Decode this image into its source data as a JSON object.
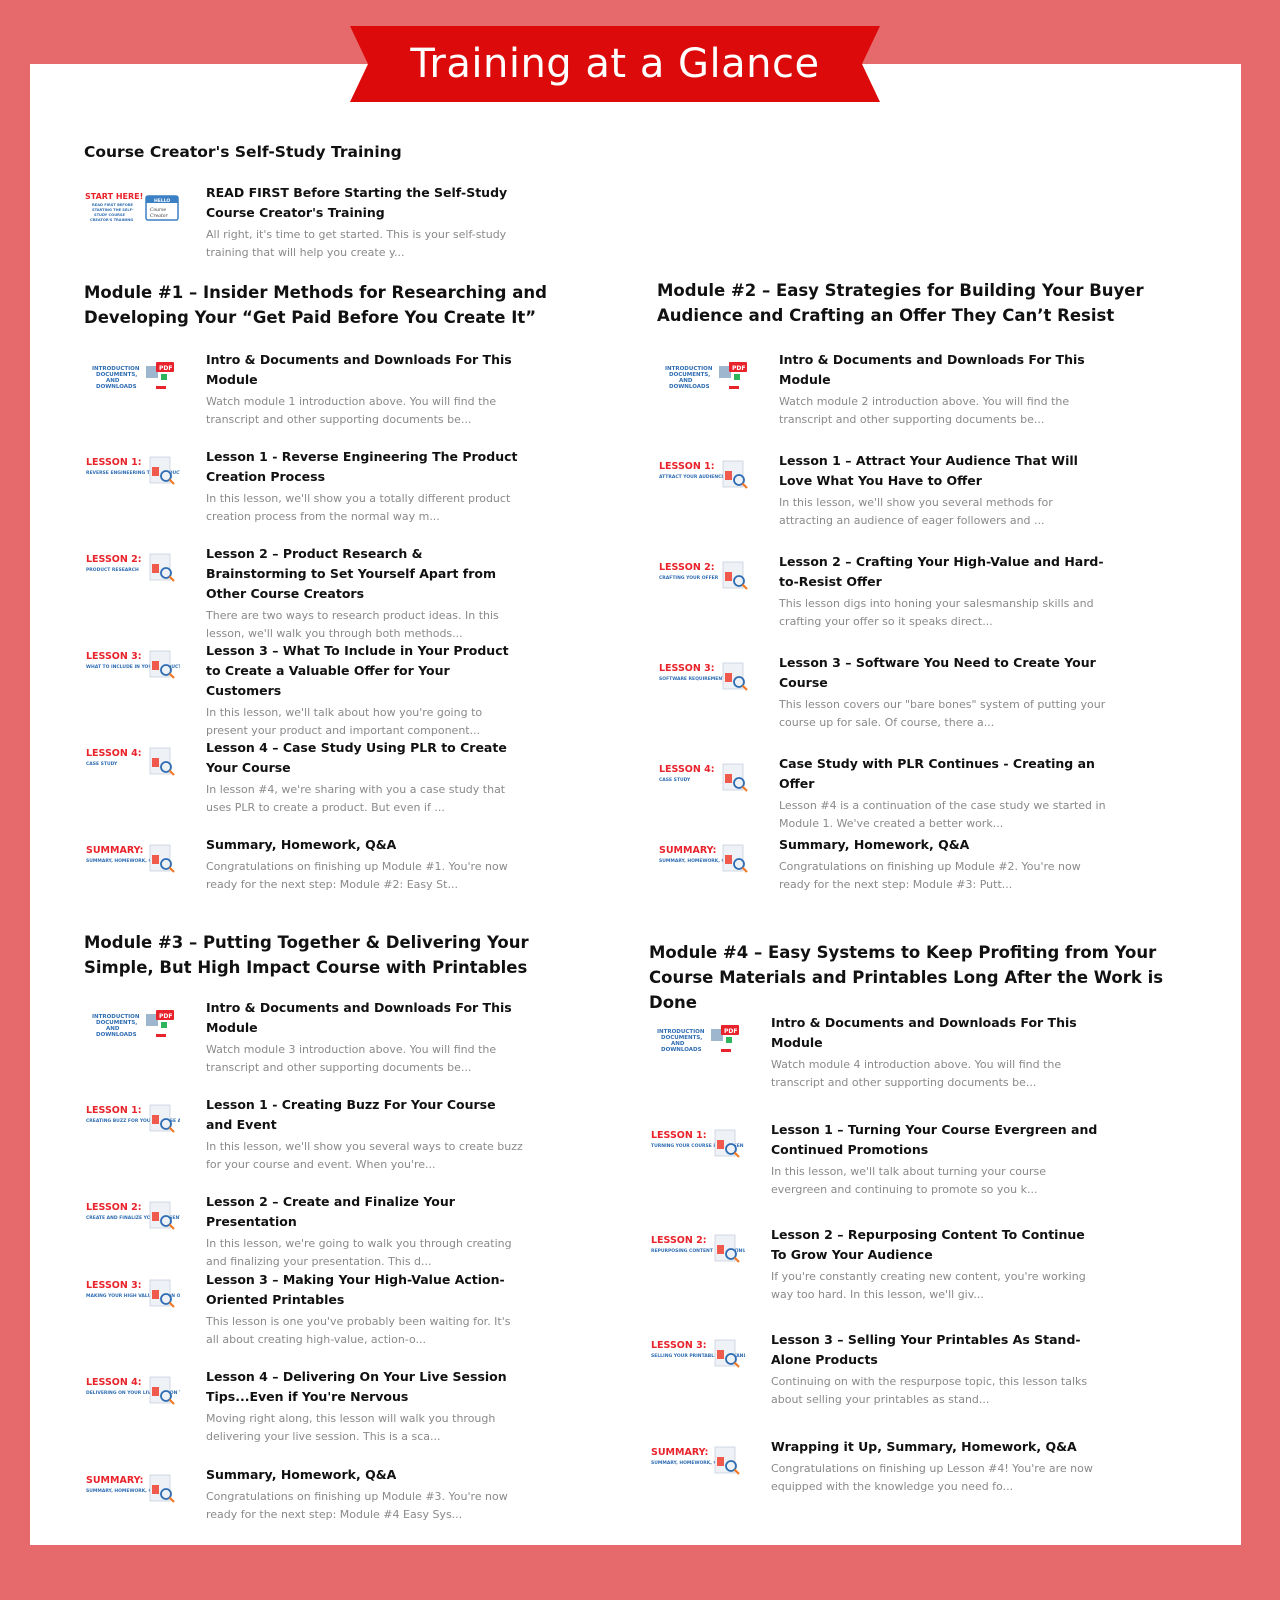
{
  "banner": {
    "title": "Training at a Glance"
  },
  "colors": {
    "frame": "#e6696b",
    "banner": "#dc0a0a",
    "panel": "#ffffff",
    "title_text": "#111111",
    "desc_text": "#8a8a8a",
    "thumb_red": "#e8232b",
    "thumb_blue": "#2f6db3"
  },
  "intro": {
    "title": "Course Creator's Self-Study Training",
    "items": [
      {
        "thumb": {
          "label": "START HERE!",
          "sub": "READ FIRST BEFORE STARTING THE SELF-STUDY COURSE CREATOR'S TRAINING",
          "icon": "name-tag-icon"
        },
        "title": "READ FIRST Before Starting the Self-Study Course Creator's Training",
        "desc": "All right, it's time to get started. This is your self-study training that will help you create y..."
      }
    ]
  },
  "modules": [
    {
      "title": "Module #1 – Insider Methods for Researching and Developing Your “Get Paid Before You Create It”",
      "items": [
        {
          "thumb": {
            "label": "INTRODUCTION DOCUMENTS, AND DOWNLOADS",
            "sub": "",
            "icon": "pdf-download-icon"
          },
          "title": "Intro & Documents and Downloads For This Module",
          "desc": "Watch module 1 introduction above. You will find the transcript and other supporting documents be..."
        },
        {
          "thumb": {
            "label": "LESSON 1:",
            "sub": "REVERSE ENGINEERING THE PRODUCT CREATION PROCESS",
            "icon": "gear-cycle-icon"
          },
          "title": "Lesson 1 - Reverse Engineering The Product Creation Process",
          "desc": "In this lesson, we'll show you a totally different product creation process from the normal way m..."
        },
        {
          "thumb": {
            "label": "LESSON 2:",
            "sub": "PRODUCT RESEARCH",
            "icon": "box-magnifier-icon"
          },
          "title": "Lesson 2 – Product Research & Brainstorming to Set Yourself Apart from Other Course Creators",
          "desc": "There are two ways to research product ideas. In this lesson, we'll walk you through both methods..."
        },
        {
          "thumb": {
            "label": "LESSON 3:",
            "sub": "WHAT TO INCLUDE IN YOUR PRODUCT",
            "icon": "checklist-icon"
          },
          "title": "Lesson 3 – What To Include in Your Product to Create a Valuable Offer for Your Customers",
          "desc": "In this lesson, we'll talk about how you're going to present your product and important component..."
        },
        {
          "thumb": {
            "label": "LESSON 4:",
            "sub": "CASE STUDY",
            "icon": "case-study-icon"
          },
          "title": "Lesson 4 – Case Study Using PLR to Create Your Course",
          "desc": "In lesson #4, we're sharing with you a case study that uses PLR to create a product. But even if ..."
        },
        {
          "thumb": {
            "label": "SUMMARY:",
            "sub": "SUMMARY, HOMEWORK, Q&A",
            "icon": "summary-doc-icon"
          },
          "title": "Summary, Homework, Q&A",
          "desc": "Congratulations on finishing up Module #1. You're now ready for the next step: Module #2: Easy St..."
        }
      ]
    },
    {
      "title": "Module #2 – Easy Strategies for Building Your Buyer Audience and Crafting an Offer They Can’t Resist",
      "items": [
        {
          "thumb": {
            "label": "INTRODUCTION DOCUMENTS, AND DOWNLOADS",
            "sub": "",
            "icon": "pdf-download-icon"
          },
          "title": "Intro & Documents and Downloads For This Module",
          "desc": "Watch module 2 introduction above. You will find the transcript and other supporting documents be..."
        },
        {
          "thumb": {
            "label": "LESSON 1:",
            "sub": "ATTRACT YOUR AUDIENCE",
            "icon": "audience-icon"
          },
          "title": "Lesson 1 – Attract Your Audience That Will Love What You Have to Offer",
          "desc": "In this lesson, we'll show you several methods for attracting an audience of eager followers and ..."
        },
        {
          "thumb": {
            "label": "LESSON 2:",
            "sub": "CRAFTING YOUR OFFER",
            "icon": "offer-icon"
          },
          "title": "Lesson 2 – Crafting Your High-Value and Hard-to-Resist Offer",
          "desc": "This lesson digs into honing your salesmanship skills and crafting your offer so it speaks direct..."
        },
        {
          "thumb": {
            "label": "LESSON 3:",
            "sub": "SOFTWARE REQUIREMENTS",
            "icon": "software-icon"
          },
          "title": "Lesson 3 – Software You Need to Create Your Course",
          "desc": "This lesson covers our \"bare bones\" system of putting your course up for sale. Of course, there a..."
        },
        {
          "thumb": {
            "label": "LESSON 4:",
            "sub": "CASE STUDY",
            "icon": "case-study-icon"
          },
          "title": "Case Study with PLR Continues - Creating an Offer",
          "desc": "Lesson #4 is a continuation of the case study we started in Module 1. We've created a better work..."
        },
        {
          "thumb": {
            "label": "SUMMARY:",
            "sub": "SUMMARY, HOMEWORK, Q&A",
            "icon": "case-study-icon"
          },
          "title": "Summary, Homework, Q&A",
          "desc": "Congratulations on finishing up Module #2.  You're now ready for the next step: Module #3: Putt..."
        }
      ]
    },
    {
      "title": "Module #3 – Putting Together & Delivering Your Simple, But High Impact Course with Printables",
      "items": [
        {
          "thumb": {
            "label": "INTRODUCTION DOCUMENTS, AND DOWNLOADS",
            "sub": "",
            "icon": "pdf-download-icon"
          },
          "title": "Intro & Documents and Downloads For This Module",
          "desc": "Watch module 3 introduction above. You will find the transcript and other supporting documents be..."
        },
        {
          "thumb": {
            "label": "LESSON 1:",
            "sub": "CREATING BUZZ FOR YOUR COURSE AND EVENT",
            "icon": "bee-buzz-icon"
          },
          "title": "Lesson 1 - Creating Buzz For Your Course and Event",
          "desc": "In this lesson, we'll show you several ways to create buzz for your course and event. When you're..."
        },
        {
          "thumb": {
            "label": "LESSON 2:",
            "sub": "CREATE AND FINALIZE YOUR PRESENTATION",
            "icon": "presentation-icon"
          },
          "title": "Lesson 2 – Create and Finalize Your Presentation",
          "desc": "In this lesson, we're going to walk you through creating and finalizing your presentation. This d..."
        },
        {
          "thumb": {
            "label": "LESSON 3:",
            "sub": "MAKING YOUR HIGH VALUE ACTION ORIENTED PRINTABLES",
            "icon": "take-action-icon"
          },
          "title": "Lesson 3 – Making Your High-Value Action-Oriented Printables",
          "desc": "This lesson is one you've probably been waiting for. It's all about creating high-value, action-o..."
        },
        {
          "thumb": {
            "label": "LESSON 4:",
            "sub": "DELIVERING ON YOUR LIVE SESSION TIPS",
            "icon": "live-session-icon"
          },
          "title": "Lesson 4 – Delivering On Your Live Session Tips...Even if You're Nervous",
          "desc": "Moving right along, this lesson will walk you through delivering your live session. This is a sca..."
        },
        {
          "thumb": {
            "label": "SUMMARY:",
            "sub": "SUMMARY, HOMEWORK, Q&A",
            "icon": "case-study-icon"
          },
          "title": "Summary, Homework, Q&A",
          "desc": "Congratulations on finishing up Module #3. You're now ready for the next step: Module #4 Easy Sys..."
        }
      ]
    },
    {
      "title": "Module #4 – Easy Systems to Keep Profiting from Your Course Materials and Printables Long After the Work is Done",
      "items": [
        {
          "thumb": {
            "label": "INTRODUCTION DOCUMENTS, AND DOWNLOADS",
            "sub": "",
            "icon": "pdf-download-icon"
          },
          "title": "Intro & Documents and Downloads For This Module",
          "desc": "Watch module 4 introduction above. You will find the transcript and other supporting documents be..."
        },
        {
          "thumb": {
            "label": "LESSON 1:",
            "sub": "TURNING YOUR COURSE EVERGREEN AND CONTINUED PROMOTIONS",
            "icon": "evergreen-promo-icon"
          },
          "title": "Lesson 1 – Turning Your Course Evergreen and Continued Promotions",
          "desc": "In this lesson, we'll talk about turning your course evergreen and continuing to promote so you k..."
        },
        {
          "thumb": {
            "label": "LESSON 2:",
            "sub": "REPURPOSING CONTENT TO CONTINUE TO GROW YOUR AUDIENCE",
            "icon": "repurpose-icon"
          },
          "title": "Lesson 2 – Repurposing Content To Continue To Grow Your Audience",
          "desc": "If you're constantly creating new content, you're working way too hard. In this lesson, we'll giv..."
        },
        {
          "thumb": {
            "label": "LESSON 3:",
            "sub": "SELLING YOUR PRINTABLES AS STAND-ALONE PRODUCTS",
            "icon": "web-browser-icon"
          },
          "title": "Lesson 3 – Selling Your Printables As Stand-Alone Products",
          "desc": "Continuing on with the respurpose topic, this lesson talks about selling your printables as stand..."
        },
        {
          "thumb": {
            "label": "SUMMARY:",
            "sub": "SUMMARY, HOMEWORK, Q&A",
            "icon": "case-study-icon"
          },
          "title": "Wrapping it Up, Summary, Homework, Q&A",
          "desc": "Congratulations on finishing up Lesson #4! You're are now equipped with the knowledge you need fo..."
        }
      ]
    }
  ]
}
